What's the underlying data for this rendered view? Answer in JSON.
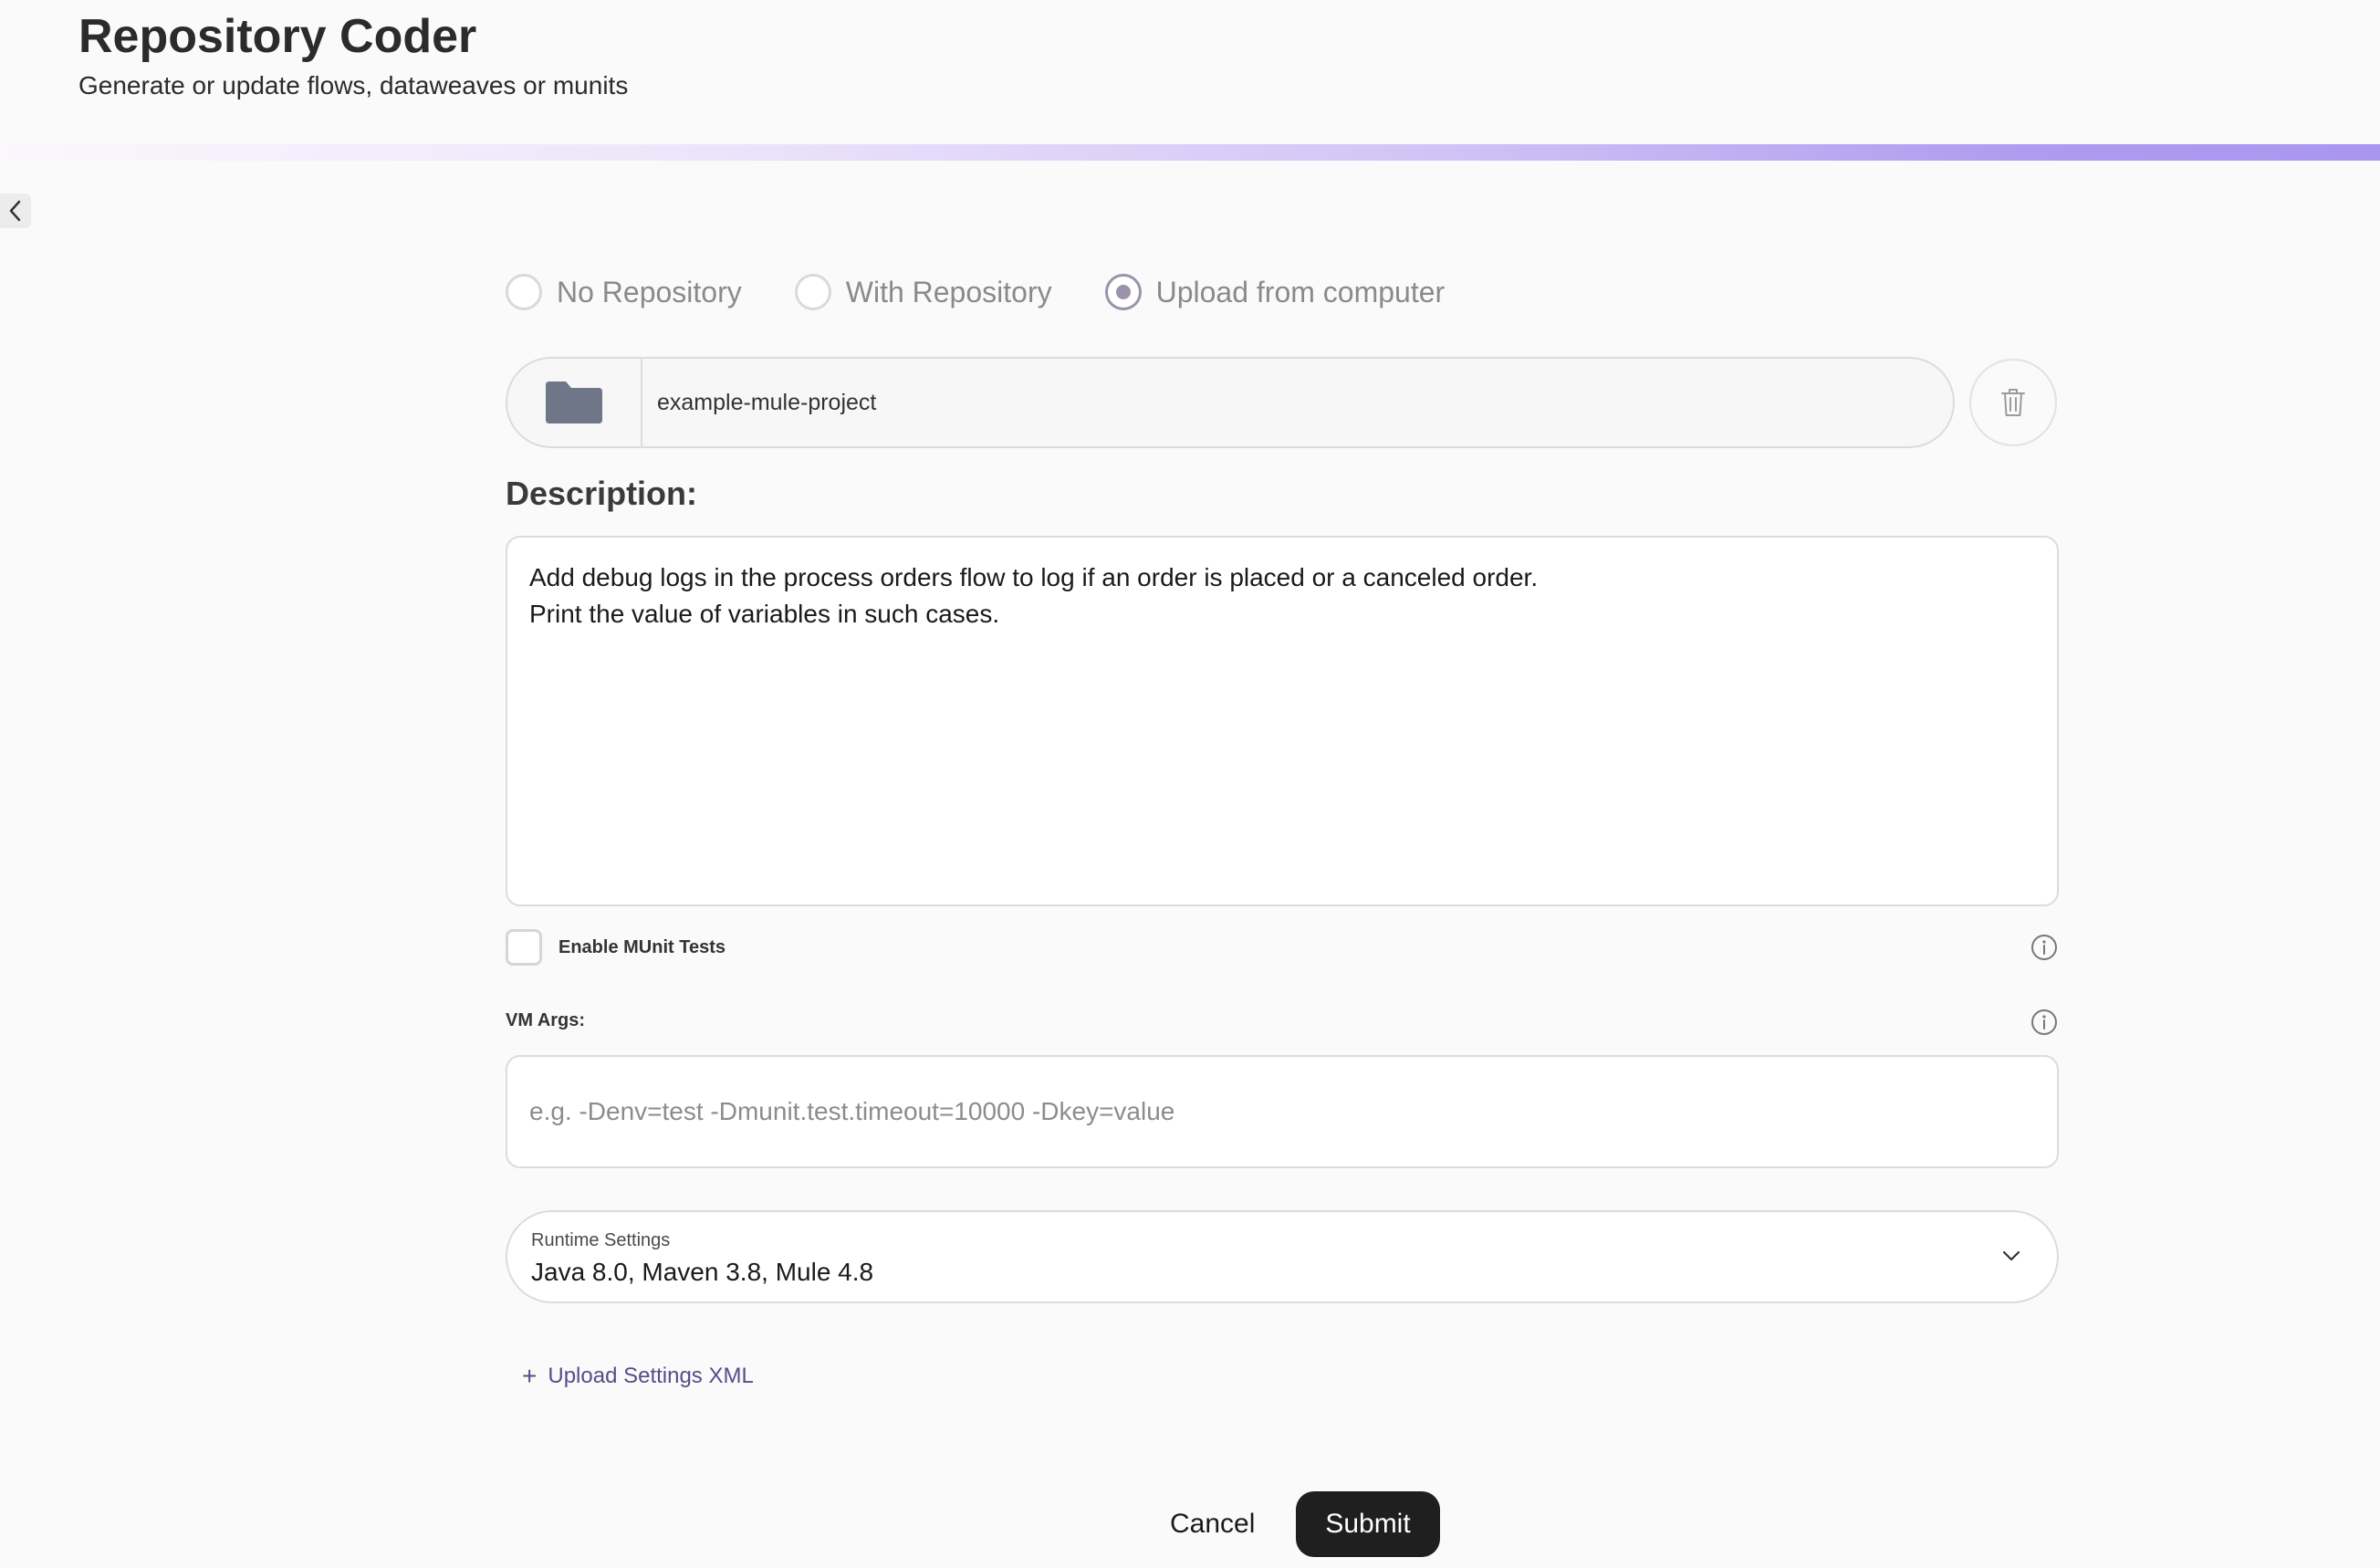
{
  "header": {
    "title": "Repository Coder",
    "subtitle": "Generate or update flows, dataweaves or munits"
  },
  "progress": {
    "fraction": 1.0
  },
  "nav": {
    "back_icon": "chevron-left-icon"
  },
  "source": {
    "options": [
      {
        "label": "No Repository",
        "checked": false
      },
      {
        "label": "With Repository",
        "checked": false
      },
      {
        "label": "Upload from computer",
        "checked": true
      }
    ]
  },
  "upload": {
    "folder_icon": "folder-icon",
    "file_name": "example-mule-project",
    "delete_icon": "trash-icon"
  },
  "description": {
    "label": "Description:",
    "lines": [
      "Add debug logs in the process orders flow to log if an order is placed or a canceled order.",
      "Print the value of variables in such cases."
    ]
  },
  "munit": {
    "label": "Enable MUnit Tests",
    "checked": false,
    "info_icon": "info-icon"
  },
  "vm_args": {
    "label": "VM Args:",
    "value": "",
    "placeholder": "e.g. -Denv=test -Dmunit.test.timeout=10000 -Dkey=value",
    "info_icon": "info-icon"
  },
  "runtime": {
    "label": "Runtime Settings",
    "value": "Java 8.0, Maven 3.8, Mule 4.8",
    "chevron_icon": "chevron-down-icon"
  },
  "settings_xml": {
    "plus": "+",
    "label": "Upload Settings XML"
  },
  "actions": {
    "cancel": "Cancel",
    "submit": "Submit"
  },
  "colors": {
    "submit_bg": "#1f1f1f",
    "link": "#5a4a8a",
    "progress_end": "#a996ef"
  }
}
